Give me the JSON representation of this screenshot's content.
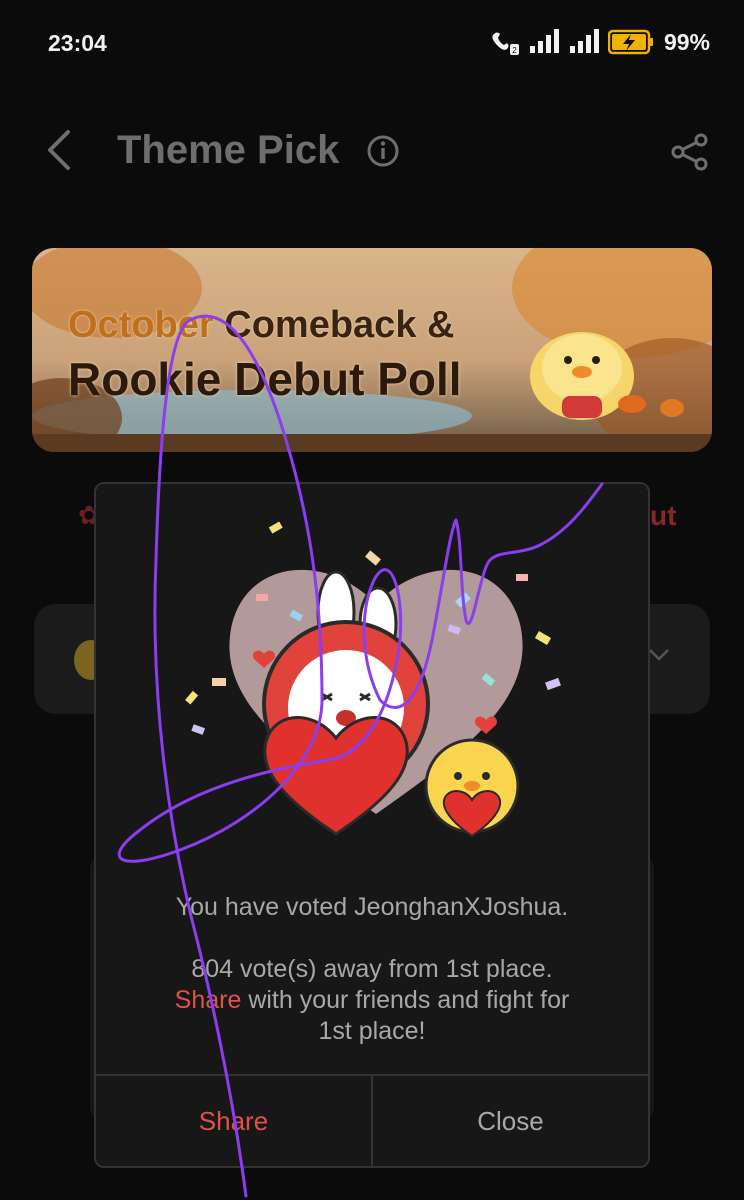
{
  "status_bar": {
    "time": "23:04",
    "battery": "99%"
  },
  "header": {
    "title": "Theme Pick",
    "icons": [
      "back-icon",
      "info-icon",
      "share-icon"
    ]
  },
  "banner": {
    "line1_accent": "October",
    "line1_rest": " Comeback &",
    "line2": "Rookie Debut Poll"
  },
  "modal": {
    "voted_text": "You have voted JeonghanXJoshua.",
    "away_text": "804 vote(s) away from 1st place.",
    "share_link": "Share",
    "share_rest": " with your friends and fight for",
    "last_line": "1st place!",
    "share_button": "Share",
    "close_button": "Close"
  },
  "background": {
    "tab_right_partial": "ut"
  },
  "colors": {
    "accent": "#e0514b",
    "background": "#0b0b0b",
    "modal": "#171717",
    "scribble": "#8b3df0"
  }
}
